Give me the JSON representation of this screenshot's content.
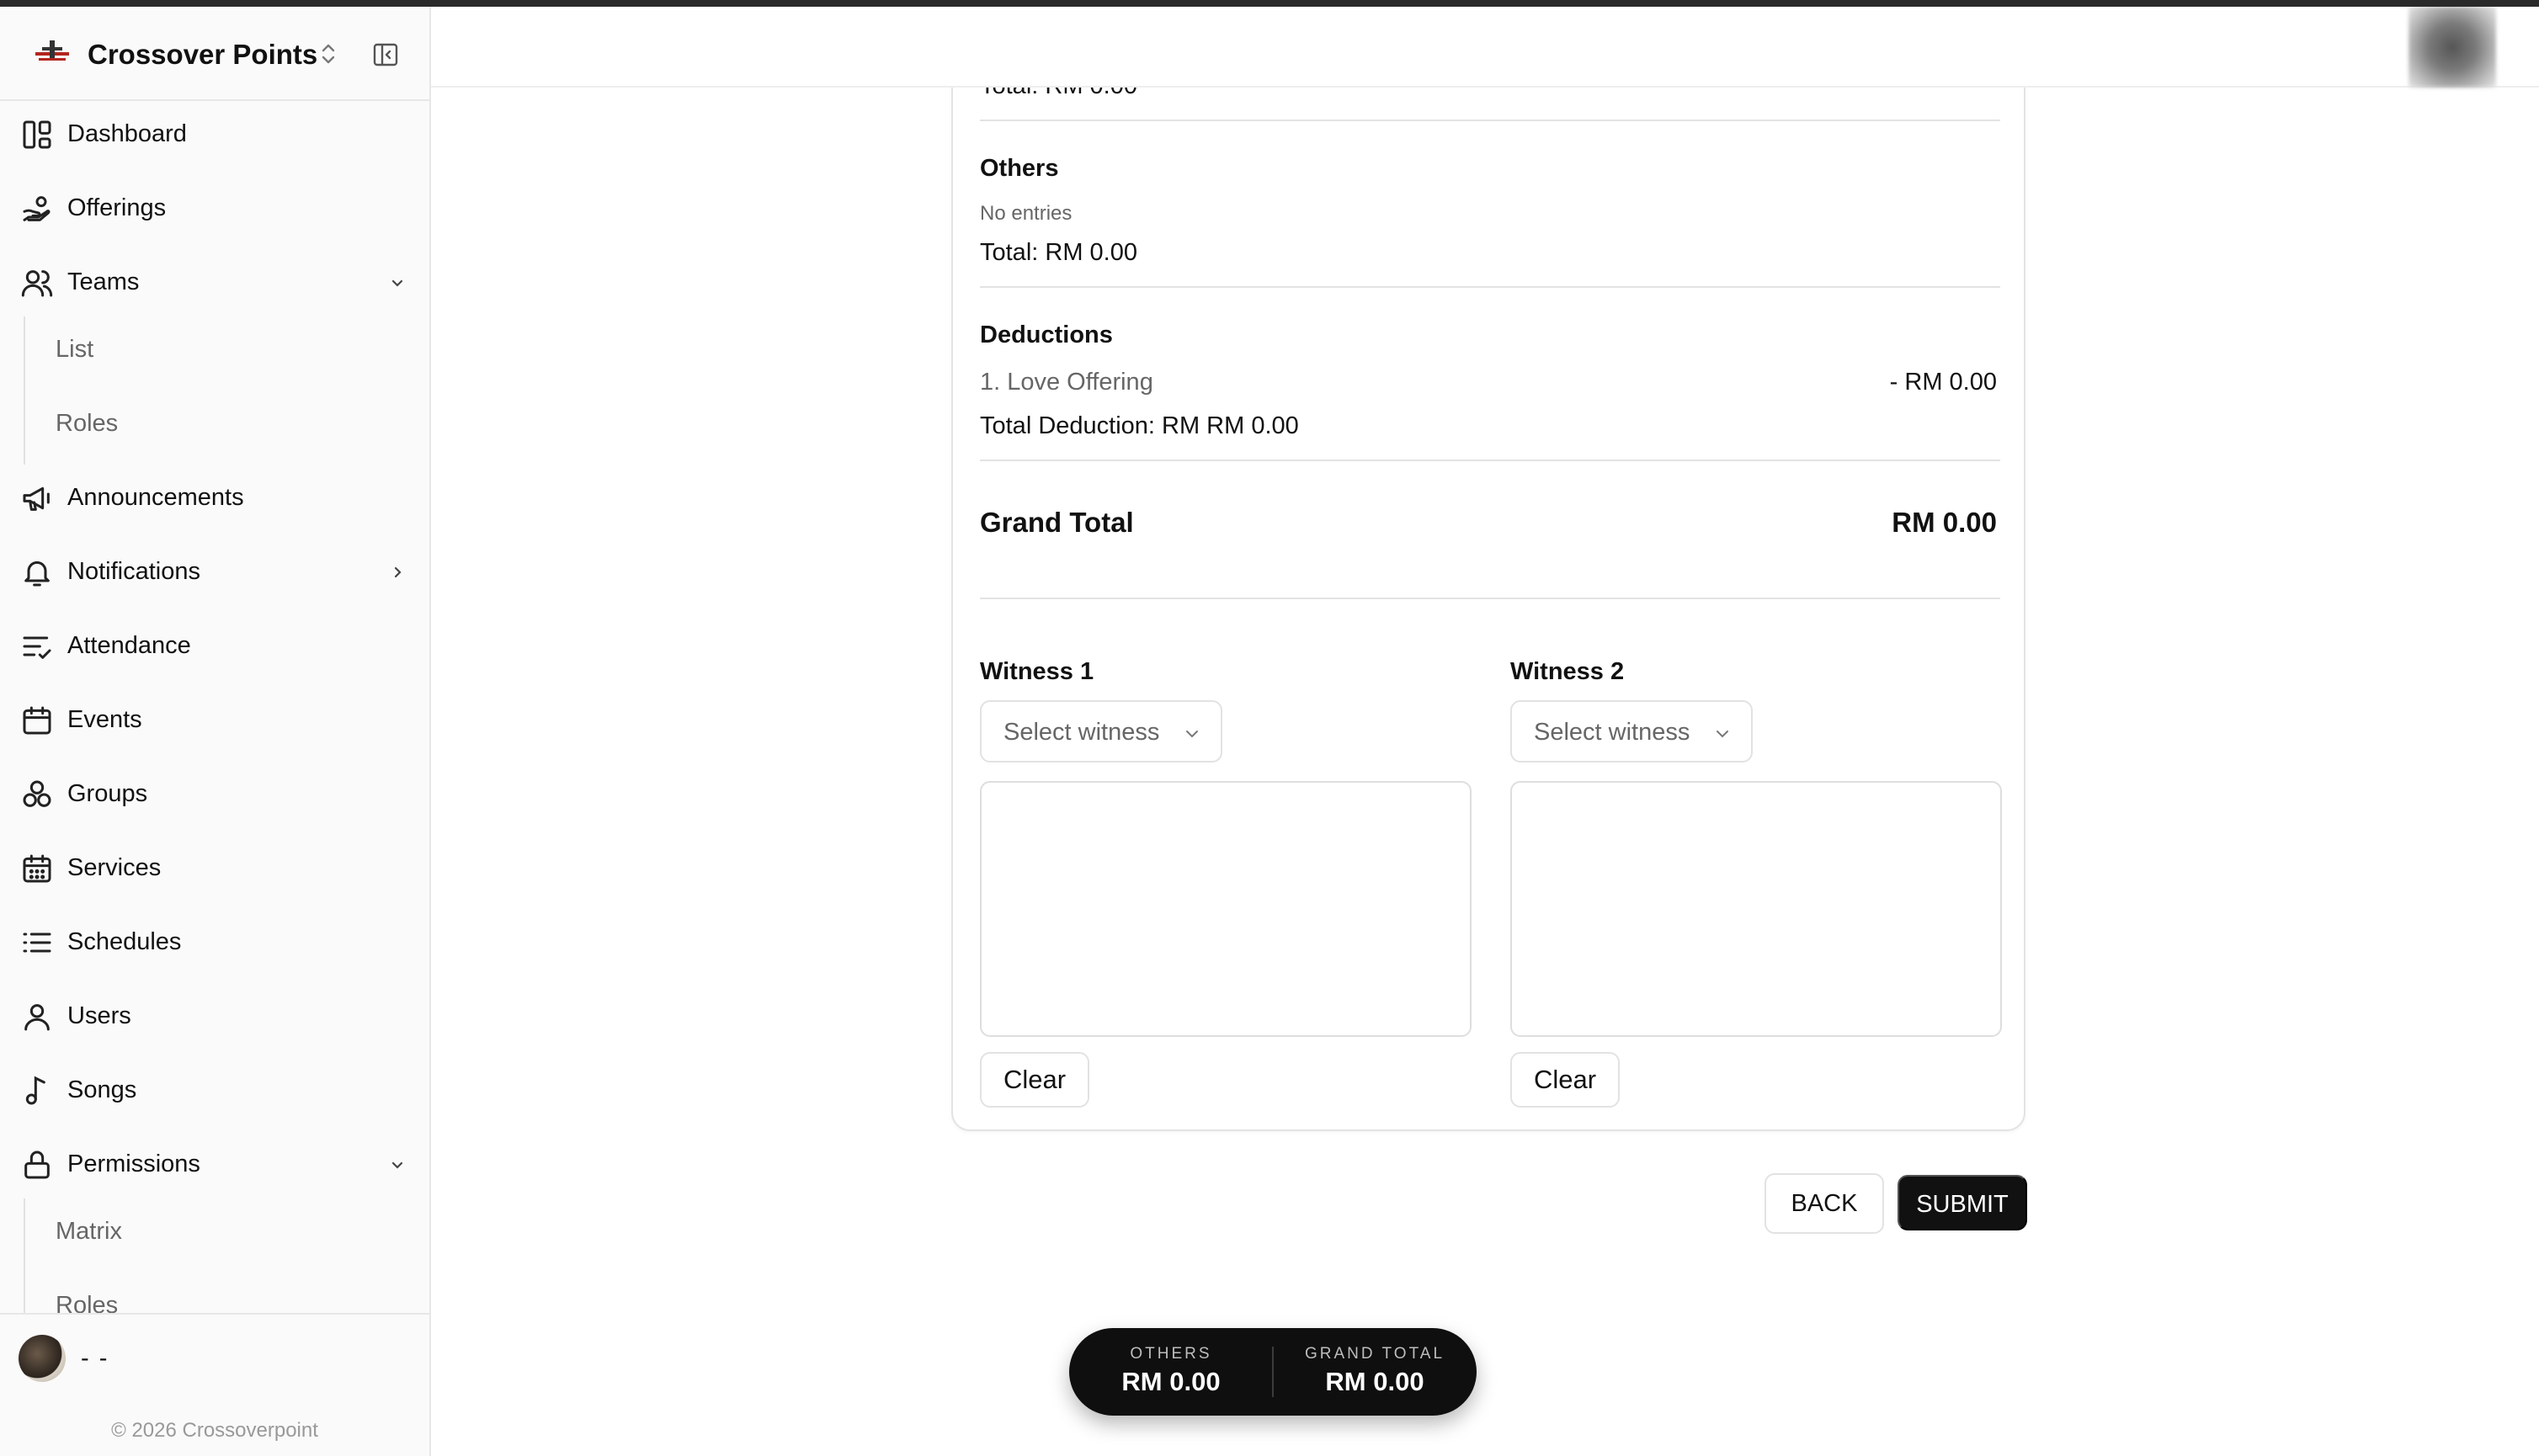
{
  "brand": {
    "name": "Crossover Points"
  },
  "sidebar": {
    "items": [
      {
        "label": "Dashboard",
        "icon": "dashboard-icon"
      },
      {
        "label": "Offerings",
        "icon": "hand-coins-icon"
      },
      {
        "label": "Teams",
        "icon": "users-icon",
        "expanded": true,
        "children": [
          "List",
          "Roles"
        ]
      },
      {
        "label": "Announcements",
        "icon": "megaphone-icon"
      },
      {
        "label": "Notifications",
        "icon": "bell-icon",
        "expanded": false
      },
      {
        "label": "Attendance",
        "icon": "list-check-icon"
      },
      {
        "label": "Events",
        "icon": "calendar-icon"
      },
      {
        "label": "Groups",
        "icon": "groups-icon"
      },
      {
        "label": "Services",
        "icon": "calendar-grid-icon"
      },
      {
        "label": "Schedules",
        "icon": "list-icon"
      },
      {
        "label": "Users",
        "icon": "user-icon"
      },
      {
        "label": "Songs",
        "icon": "music-note-icon"
      },
      {
        "label": "Permissions",
        "icon": "lock-icon",
        "expanded": true,
        "children": [
          "Matrix",
          "Roles"
        ]
      }
    ],
    "user_name": "- -",
    "copyright": "© 2026 Crossoverpoint"
  },
  "card": {
    "prev_total": "Total: RM 0.00",
    "others": {
      "title": "Others",
      "empty_text": "No entries",
      "total": "Total: RM 0.00"
    },
    "deductions": {
      "title": "Deductions",
      "items": [
        {
          "name": "1. Love Offering",
          "amount": "- RM 0.00"
        }
      ],
      "total": "Total Deduction: RM RM 0.00"
    },
    "grand_total": {
      "label": "Grand Total",
      "value": "RM 0.00"
    },
    "witnesses": [
      {
        "label": "Witness 1",
        "placeholder": "Select witness",
        "clear_label": "Clear"
      },
      {
        "label": "Witness 2",
        "placeholder": "Select witness",
        "clear_label": "Clear"
      }
    ]
  },
  "actions": {
    "back_label": "BACK",
    "submit_label": "SUBMIT"
  },
  "summary": {
    "others_caption": "OTHERS",
    "others_value": "RM 0.00",
    "grand_caption": "GRAND TOTAL",
    "grand_value": "RM 0.00"
  },
  "colors": {
    "accent": "#111111",
    "muted_text": "#666666",
    "border": "#e3e3e3",
    "sidebar_bg": "#fafafa"
  }
}
